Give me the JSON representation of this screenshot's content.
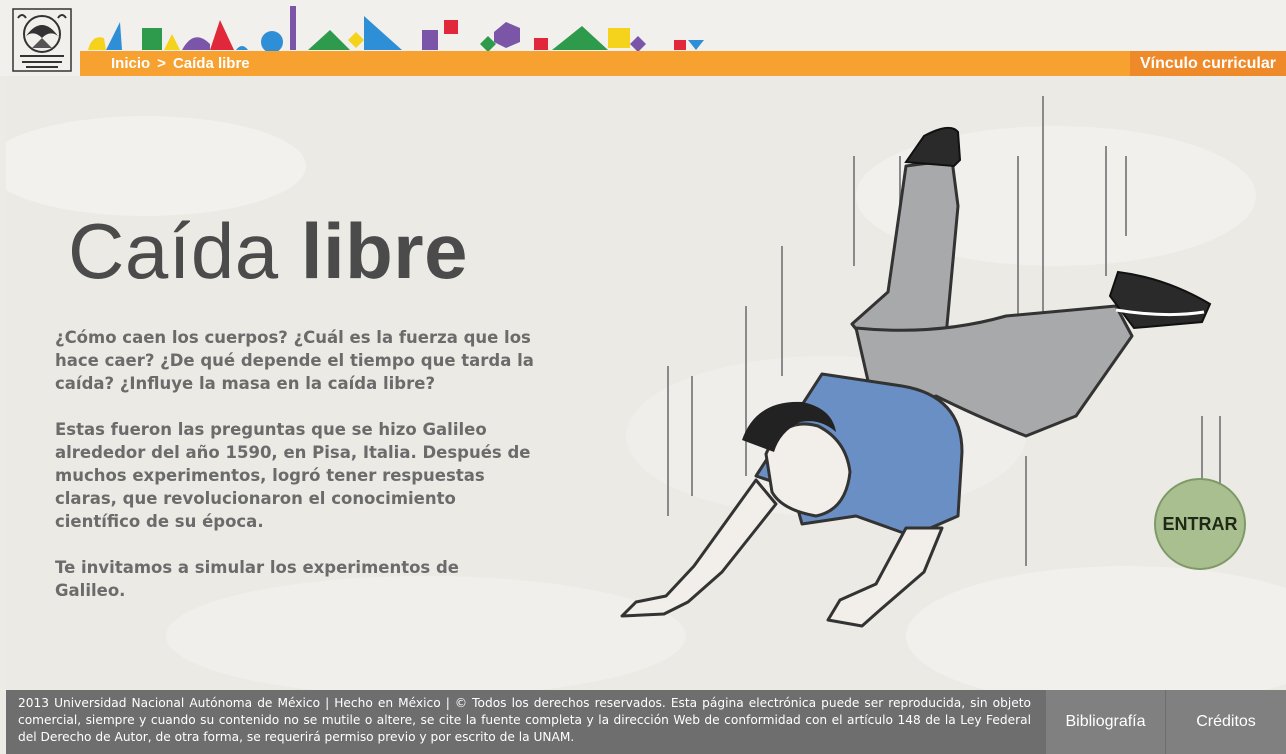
{
  "breadcrumb": {
    "home": "Inicio",
    "separator": ">",
    "current": "Caída libre"
  },
  "header": {
    "curricular_link": "Vínculo curricular"
  },
  "hero": {
    "title_light": "Caída",
    "title_bold": "libre",
    "paragraphs": [
      "¿Cómo caen los cuerpos? ¿Cuál es la fuerza que los hace caer? ¿De qué depende el tiempo que tarda la caída? ¿Influye la masa en la caída libre?",
      "Estas fueron las preguntas que se hizo Galileo alrededor del año 1590, en Pisa, Italia. Después de muchos experimentos, logró tener respuestas claras, que revolucionaron el conocimiento científico de su época.",
      "Te invitamos a simular los experimentos de Galileo."
    ],
    "enter_label": "ENTRAR"
  },
  "footer": {
    "legal": "2013 Universidad Nacional Autónoma de México | Hecho en México | © Todos los derechos reservados. Esta página electrónica puede ser reproducida, sin objeto comercial, siempre y cuando su contenido no se mutile o altere, se cite la fuente completa y la dirección Web de conformidad con el artículo 148 de la Ley Federal del Derecho de Autor, de otra forma, se requerirá permiso previo y por escrito de la UNAM.",
    "bibliography_label": "Bibliografía",
    "credits_label": "Créditos"
  },
  "colors": {
    "nav_orange": "#f7a131",
    "nav_orange_dark": "#ee8a2a",
    "enter_green": "#a9bf8f",
    "footer_gray": "#6e6e6e",
    "shirt_blue": "#6a8fc4",
    "pants_gray": "#a8a9ab"
  },
  "icons": {
    "logo": "unam-seal-icon",
    "decor": "geometric-shapes-banner"
  }
}
